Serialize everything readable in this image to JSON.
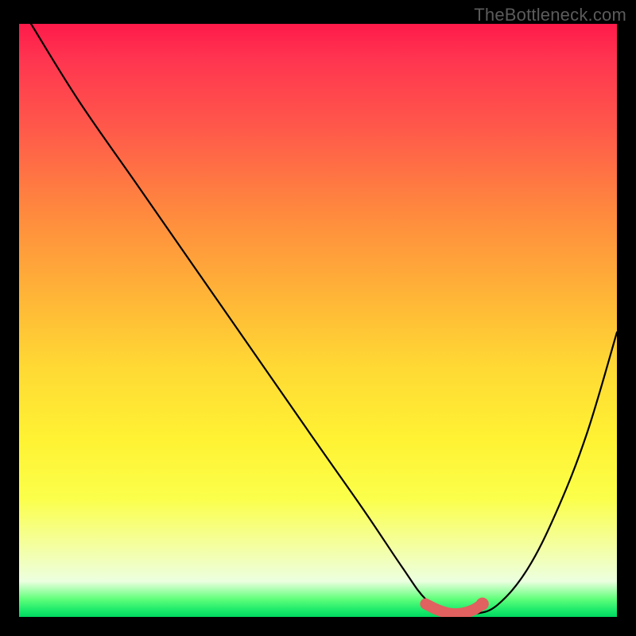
{
  "watermark": "TheBottleneck.com",
  "chart_data": {
    "type": "line",
    "title": "",
    "xlabel": "",
    "ylabel": "",
    "xlim": [
      0,
      100
    ],
    "ylim": [
      0,
      100
    ],
    "grid": false,
    "legend": false,
    "series": [
      {
        "name": "bottleneck-curve",
        "x": [
          2,
          10,
          20,
          30,
          40,
          50,
          58,
          64,
          68,
          72,
          76,
          80,
          85,
          90,
          95,
          100
        ],
        "y": [
          100,
          87,
          72.5,
          58,
          43.5,
          29,
          17.5,
          8.5,
          3,
          0.5,
          0.5,
          2,
          8,
          18,
          31,
          48
        ]
      }
    ],
    "highlight_segment": {
      "name": "optimal-range",
      "x": [
        68,
        70,
        72,
        74,
        76,
        77.5
      ],
      "y": [
        2.2,
        1.2,
        0.6,
        0.6,
        1.2,
        2.2
      ]
    },
    "highlight_endpoint": {
      "x": 77.5,
      "y": 2.2
    },
    "colors": {
      "curve": "#000000",
      "highlight": "#e0615f",
      "gradient_top": "#ff1a4a",
      "gradient_mid": "#ffe734",
      "gradient_bottom": "#00d760"
    }
  }
}
